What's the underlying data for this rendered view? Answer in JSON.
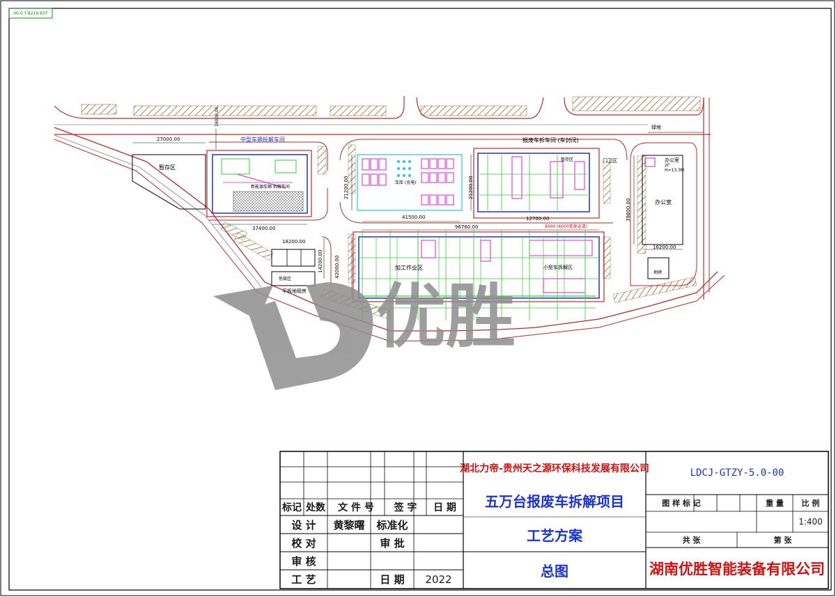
{
  "sheet": {
    "corner_tag": "00-0 T-8219-E0T"
  },
  "site_labels": {
    "storage_area": "暂存区",
    "mid_dismantle": "中型车辆拆解车间",
    "special_dismantle": "新能源车辆 拆解车间",
    "scrap_dismantle": "报废车拆车间 (车封闭)",
    "office_building": "办公室",
    "office_small": "办公室",
    "office_floors": "2F",
    "office_height": "H=13.3M",
    "parking": "车库 (充电)",
    "processing_area": "加工作业区",
    "small_dismantle": "小型车拆解区",
    "guard": "门卫区",
    "road_label": "绿地",
    "weighbridge": "地磅",
    "scale_room": "平板地磅房",
    "hazard_room": "危废区",
    "storage_b": "暂存区"
  },
  "dimensions": {
    "d27000": "27000.00",
    "d18000": "18000.00",
    "d37400": "37400.00",
    "d18200": "18200.00",
    "d21200a": "21200.00",
    "d21200b": "21200.00",
    "d41500": "41500.00",
    "d96760": "96760.00",
    "d12700": "12700.00",
    "d39800": "39800.00",
    "d16200": "16200.00",
    "d42000": "42000.00",
    "d14200": "14200.00",
    "d_red": "8000 (6000宽发运道)"
  },
  "title_block": {
    "rev_headers": {
      "mark": "标记",
      "count": "处数",
      "doc_no": "文 件 号",
      "sign": "签  字",
      "date": "日  期"
    },
    "design_label": "设  计",
    "designer": "黄黎曙",
    "standard_label": "标准化",
    "check_label": "校  对",
    "approve_label": "审  批",
    "review_label": "审  核",
    "process_label": "工  艺",
    "date_label": "日  期",
    "year": "2022",
    "client": "湖北力帝-贵州天之源环保科技发展有限公司",
    "project": "五万台报废车拆解项目",
    "scheme": "工艺方案",
    "drawing_name": "总图",
    "drawing_no": "LDCJ-GTZY-5.0-00",
    "mark_label": "图 样 标 记",
    "weight_label": "重  量",
    "scale_label": "比  例",
    "scale_value": "1:400",
    "total_label": "共          张",
    "sheet_label": "第          张",
    "company": "湖南优胜智能装备有限公司"
  },
  "watermark": {
    "text": "优胜"
  },
  "colors": {
    "frame": "#000000",
    "road_red": "#c62828",
    "wall_blue": "#1a33d6",
    "green_line": "#2bd52b",
    "magenta": "#e21ee0",
    "cyan": "#21c6e8",
    "hatch_brown": "#8a5a2b",
    "watermark_gray": "#8e8e8e"
  }
}
